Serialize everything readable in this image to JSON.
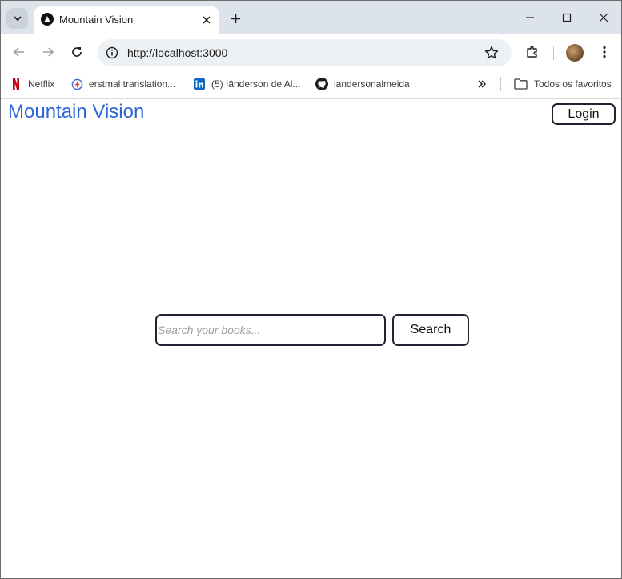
{
  "browser": {
    "tab": {
      "title": "Mountain Vision"
    },
    "address": {
      "url": "http://localhost:3000"
    },
    "bookmarks": [
      {
        "label": "Netflix",
        "icon": "netflix-icon"
      },
      {
        "label": "erstmal translation...",
        "icon": "translation-icon"
      },
      {
        "label": "(5) Iânderson de Al...",
        "icon": "linkedin-icon"
      },
      {
        "label": "iandersonalmeida",
        "icon": "github-icon"
      }
    ],
    "all_bookmarks_label": "Todos os favoritos"
  },
  "page": {
    "brand": "Mountain Vision",
    "login_label": "Login",
    "search": {
      "placeholder": "Search your books...",
      "value": "",
      "button_label": "Search"
    }
  },
  "colors": {
    "brand": "#2f66d6",
    "border": "#1f2433",
    "tabstrip": "#dde3ea"
  }
}
